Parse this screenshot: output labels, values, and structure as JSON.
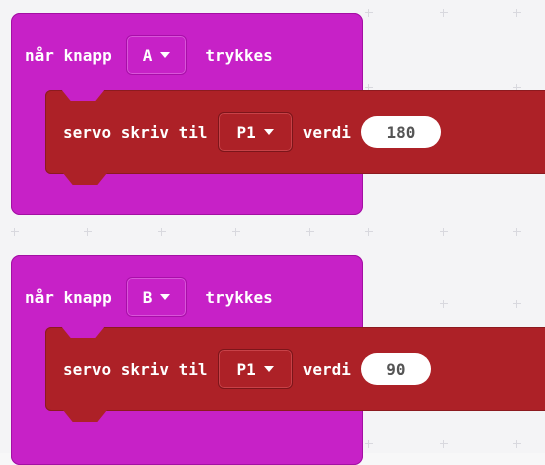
{
  "blocks": [
    {
      "prefix": "når knapp",
      "button": "A",
      "suffix": "trykkes",
      "statement": {
        "verb": "servo skriv til",
        "pin": "P1",
        "value_label": "verdi",
        "value": "180"
      }
    },
    {
      "prefix": "når knapp",
      "button": "B",
      "suffix": "trykkes",
      "statement": {
        "verb": "servo skriv til",
        "pin": "P1",
        "value_label": "verdi",
        "value": "90"
      }
    }
  ],
  "colors": {
    "event": "#c721c7",
    "servo": "#ad2127",
    "workspace": "#f4f4f6"
  },
  "icons": {
    "dropdown": "chevron-down-icon"
  }
}
